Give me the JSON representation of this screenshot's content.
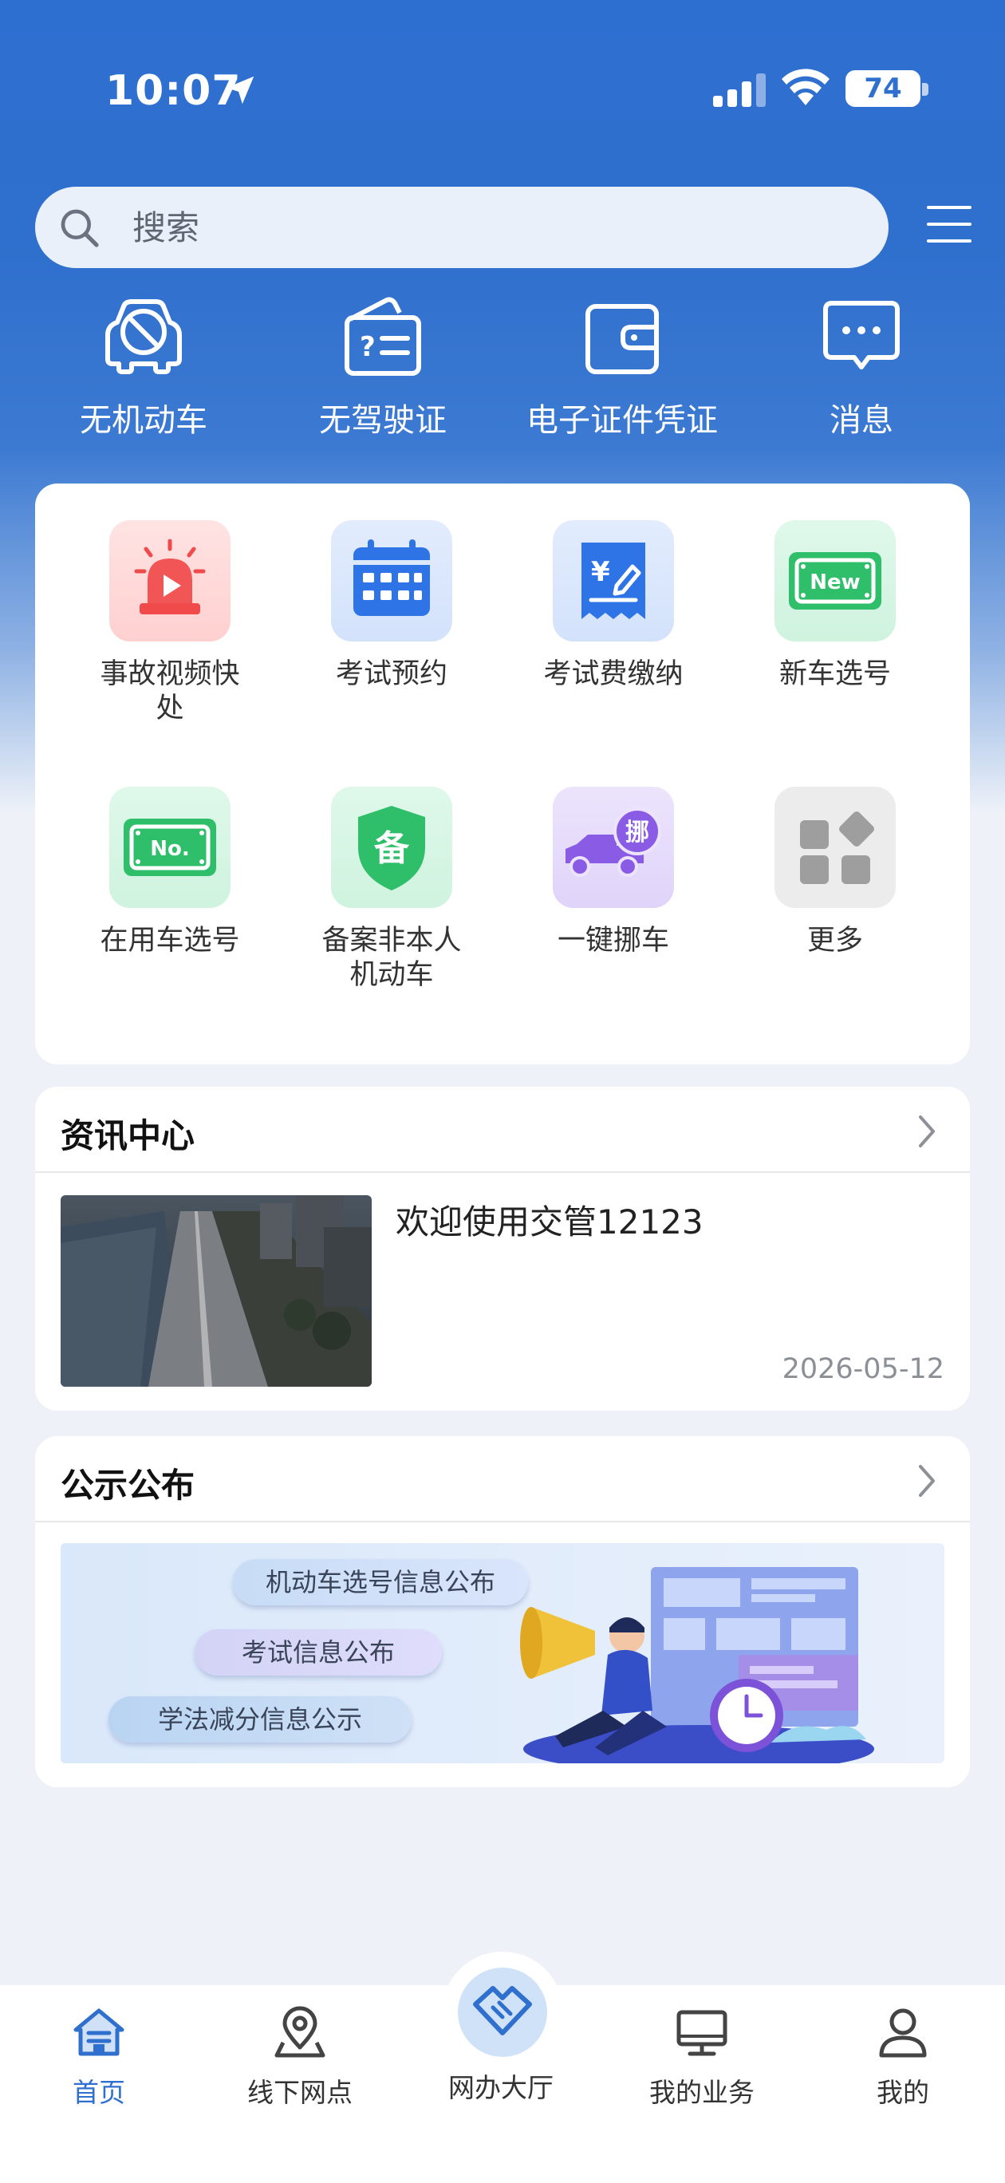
{
  "status_bar": {
    "time": "10:07",
    "battery": "74"
  },
  "search": {
    "placeholder": "搜索"
  },
  "quick_actions": [
    {
      "label": "无机动车",
      "icon": "car-prohibited-icon"
    },
    {
      "label": "无驾驶证",
      "icon": "license-question-icon"
    },
    {
      "label": "电子证件凭证",
      "icon": "wallet-icon"
    },
    {
      "label": "消息",
      "icon": "message-icon"
    }
  ],
  "services": [
    {
      "label": "事故视频快处",
      "icon": "siren-video-icon",
      "color": "#f04a4a"
    },
    {
      "label": "考试预约",
      "icon": "calendar-icon",
      "color": "#2f74e6"
    },
    {
      "label": "考试费缴纳",
      "icon": "receipt-yen-icon",
      "color": "#2f74e6"
    },
    {
      "label": "新车选号",
      "icon": "new-plate-icon",
      "color": "#2fbf6a"
    },
    {
      "label": "在用车选号",
      "icon": "no-plate-icon",
      "color": "#2fbf6a"
    },
    {
      "label": "备案非本人机动车",
      "icon": "shield-record-icon",
      "color": "#2fbf6a"
    },
    {
      "label": "一键挪车",
      "icon": "tow-truck-icon",
      "color": "#8a5ce6"
    },
    {
      "label": "更多",
      "icon": "more-grid-icon",
      "color": "#9e9e9e"
    }
  ],
  "news": {
    "title": "资讯中心",
    "item_title": "欢迎使用交管12123",
    "item_date": "2026-05-12"
  },
  "notice": {
    "title": "公示公布",
    "pills": [
      "机动车选号信息公布",
      "考试信息公布",
      "学法减分信息公示"
    ]
  },
  "tabs": [
    {
      "label": "首页",
      "icon": "home-icon",
      "active": true
    },
    {
      "label": "线下网点",
      "icon": "location-pin-icon",
      "active": false
    },
    {
      "label": "网办大厅",
      "icon": "handshake-icon",
      "active": false
    },
    {
      "label": "我的业务",
      "icon": "monitor-icon",
      "active": false
    },
    {
      "label": "我的",
      "icon": "user-icon",
      "active": false
    }
  ],
  "colors": {
    "accent": "#2f6fcd"
  }
}
